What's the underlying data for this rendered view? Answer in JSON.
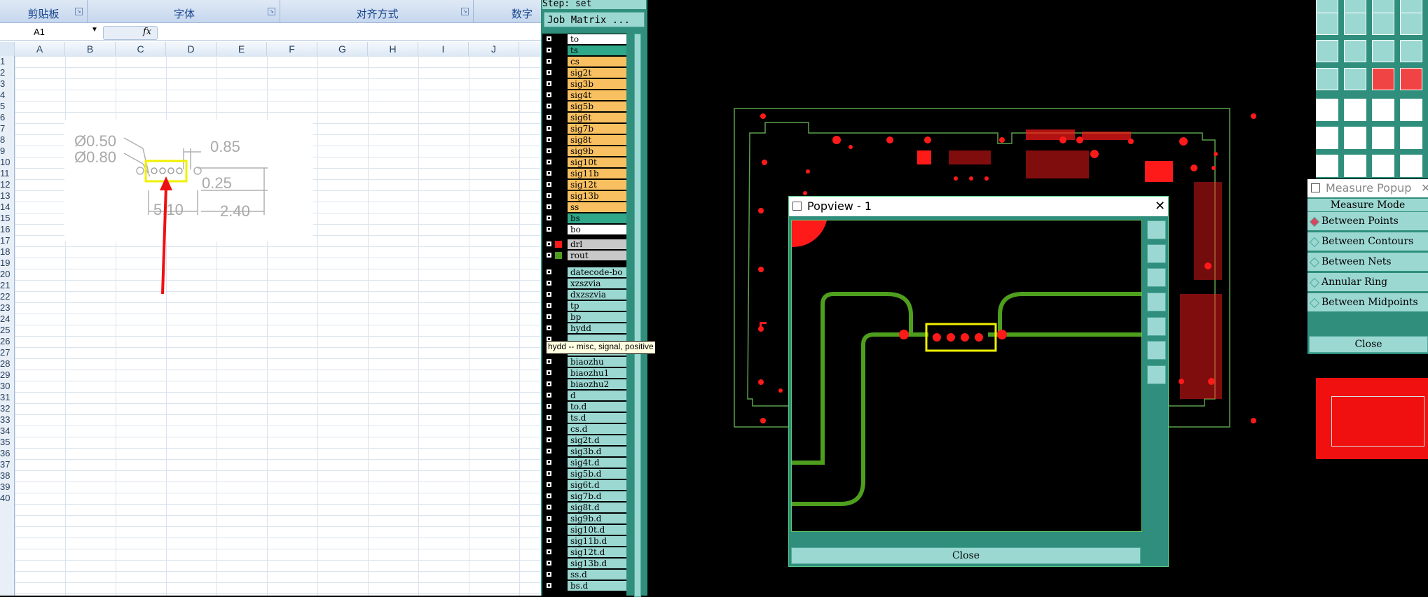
{
  "excel": {
    "ribbon_groups": [
      "剪贴板",
      "字体",
      "对齐方式",
      "数字"
    ],
    "name_box": "A1",
    "fx": "fx",
    "columns": [
      "A",
      "B",
      "C",
      "D",
      "E",
      "F",
      "G",
      "H",
      "I",
      "J"
    ],
    "rows": [
      "1",
      "2",
      "3",
      "4",
      "5",
      "6",
      "7",
      "8",
      "9",
      "10",
      "11",
      "12",
      "13",
      "14",
      "15",
      "16",
      "17",
      "18",
      "19",
      "20",
      "21",
      "22",
      "23",
      "24",
      "25",
      "26",
      "27",
      "28",
      "29",
      "30",
      "31",
      "32",
      "33",
      "34",
      "35",
      "36",
      "37",
      "38",
      "39",
      "40"
    ],
    "drawing": {
      "dim1": "Ø0.50",
      "dim2": "Ø0.80",
      "dim3": "0.85",
      "dim4": "0.25",
      "dim5": "5.10",
      "dim6": "2.40"
    }
  },
  "incam": {
    "step": "Step: set",
    "job_matrix": "Job Matrix ...",
    "layers": [
      {
        "name": "to",
        "color": "#ffffff"
      },
      {
        "name": "ts",
        "color": "#2fa88a"
      },
      {
        "name": "cs",
        "color": "#f8c060"
      },
      {
        "name": "sig2t",
        "color": "#f8c060"
      },
      {
        "name": "sig3b",
        "color": "#f8c060"
      },
      {
        "name": "sig4t",
        "color": "#f8c060"
      },
      {
        "name": "sig5b",
        "color": "#f8c060"
      },
      {
        "name": "sig6t",
        "color": "#f8c060"
      },
      {
        "name": "sig7b",
        "color": "#f8c060"
      },
      {
        "name": "sig8t",
        "color": "#f8c060"
      },
      {
        "name": "sig9b",
        "color": "#f8c060"
      },
      {
        "name": "sig10t",
        "color": "#f8c060"
      },
      {
        "name": "sig11b",
        "color": "#f8c060"
      },
      {
        "name": "sig12t",
        "color": "#f8c060"
      },
      {
        "name": "sig13b",
        "color": "#f8c060"
      },
      {
        "name": "ss",
        "color": "#f8c060"
      },
      {
        "name": "bs",
        "color": "#2fa88a"
      },
      {
        "name": "bo",
        "color": "#ffffff"
      },
      {
        "name": "drl",
        "color": "#c8c8c8"
      },
      {
        "name": "rout",
        "color": "#c8c8c8"
      },
      {
        "name": "datecode-bo",
        "color": "#9cd8d2"
      },
      {
        "name": "xzszvia",
        "color": "#9cd8d2"
      },
      {
        "name": "dxzszvia",
        "color": "#9cd8d2"
      },
      {
        "name": "tp",
        "color": "#9cd8d2"
      },
      {
        "name": "bp",
        "color": "#9cd8d2"
      },
      {
        "name": "hydd",
        "color": "#9cd8d2"
      },
      {
        "name": "",
        "color": "#9cd8d2"
      },
      {
        "name": "",
        "color": "#9cd8d2"
      },
      {
        "name": "biaozhu",
        "color": "#9cd8d2"
      },
      {
        "name": "biaozhu1",
        "color": "#9cd8d2"
      },
      {
        "name": "biaozhu2",
        "color": "#9cd8d2"
      },
      {
        "name": "d",
        "color": "#9cd8d2"
      },
      {
        "name": "to.d",
        "color": "#9cd8d2"
      },
      {
        "name": "ts.d",
        "color": "#9cd8d2"
      },
      {
        "name": "cs.d",
        "color": "#9cd8d2"
      },
      {
        "name": "sig2t.d",
        "color": "#9cd8d2"
      },
      {
        "name": "sig3b.d",
        "color": "#9cd8d2"
      },
      {
        "name": "sig4t.d",
        "color": "#9cd8d2"
      },
      {
        "name": "sig5b.d",
        "color": "#9cd8d2"
      },
      {
        "name": "sig6t.d",
        "color": "#9cd8d2"
      },
      {
        "name": "sig7b.d",
        "color": "#9cd8d2"
      },
      {
        "name": "sig8t.d",
        "color": "#9cd8d2"
      },
      {
        "name": "sig9b.d",
        "color": "#9cd8d2"
      },
      {
        "name": "sig10t.d",
        "color": "#9cd8d2"
      },
      {
        "name": "sig11b.d",
        "color": "#9cd8d2"
      },
      {
        "name": "sig12t.d",
        "color": "#9cd8d2"
      },
      {
        "name": "sig13b.d",
        "color": "#9cd8d2"
      },
      {
        "name": "ss.d",
        "color": "#9cd8d2"
      },
      {
        "name": "bs.d",
        "color": "#9cd8d2"
      }
    ],
    "tooltip": "hydd -- misc, signal, positive"
  },
  "popview": {
    "title": "Popview - 1",
    "close_label": "Close"
  },
  "measure": {
    "title": "Measure Popup",
    "mode_label": "Measure Mode",
    "options": [
      "Between Points",
      "Between Contours",
      "Between Nets",
      "Annular Ring",
      "Between Midpoints"
    ],
    "selected": "Between Points",
    "close_label": "Close"
  }
}
